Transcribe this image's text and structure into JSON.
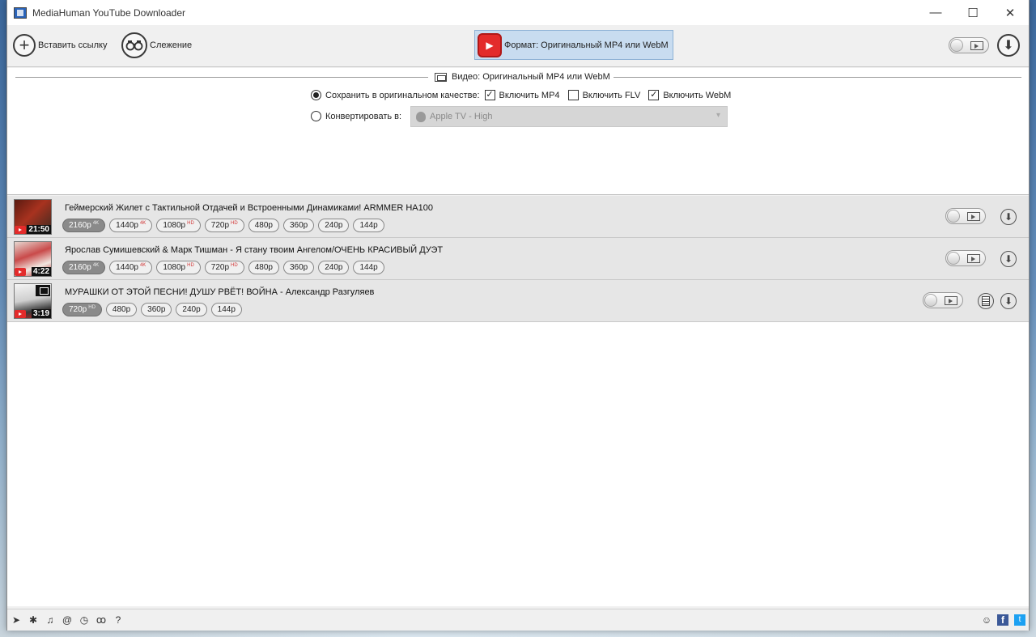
{
  "window": {
    "title": "MediaHuman YouTube Downloader"
  },
  "titlebar": {
    "minimize": "—",
    "maximize": "☐",
    "close": "✕"
  },
  "toolbar": {
    "paste_label": "Вставить ссылку",
    "tracking_label": "Слежение",
    "format_label": "Формат: Оригинальный MP4 или WebM"
  },
  "format_panel": {
    "title": "Видео: Оригинальный MP4 или WebM",
    "keep_original_label": "Сохранить в оригинальном качестве:",
    "include_mp4_label": "Включить MP4",
    "include_flv_label": "Включить FLV",
    "include_webm_label": "Включить WebM",
    "convert_label": "Конвертировать в:",
    "convert_preset": "Apple TV - High",
    "keep_original_selected": true,
    "include_mp4": true,
    "include_flv": false,
    "include_webm": true
  },
  "videos": [
    {
      "title": "Геймерский Жилет с Тактильной Отдачей и Встроенными Динамиками! ARMMER HA100",
      "duration": "21:50",
      "qualities": [
        {
          "label": "2160p",
          "badge": "4K",
          "selected": true
        },
        {
          "label": "1440p",
          "badge": "4K"
        },
        {
          "label": "1080p",
          "badge": "HD"
        },
        {
          "label": "720p",
          "badge": "HD"
        },
        {
          "label": "480p",
          "badge": ""
        },
        {
          "label": "360p",
          "badge": ""
        },
        {
          "label": "240p",
          "badge": ""
        },
        {
          "label": "144p",
          "badge": ""
        }
      ]
    },
    {
      "title": "Ярослав Сумишевский & Марк Тишман - Я стану твоим Ангелом/ОЧЕНЬ КРАСИВЫЙ ДУЭТ",
      "duration": "4:22",
      "qualities": [
        {
          "label": "2160p",
          "badge": "4K",
          "selected": true
        },
        {
          "label": "1440p",
          "badge": "4K"
        },
        {
          "label": "1080p",
          "badge": "HD"
        },
        {
          "label": "720p",
          "badge": "HD"
        },
        {
          "label": "480p",
          "badge": ""
        },
        {
          "label": "360p",
          "badge": ""
        },
        {
          "label": "240p",
          "badge": ""
        },
        {
          "label": "144p",
          "badge": ""
        }
      ]
    },
    {
      "title": "МУРАШКИ ОТ ЭТОЙ ПЕСНИ! ДУШУ РВЁТ! ВОЙНА - Александр Разгуляев",
      "duration": "3:19",
      "qualities": [
        {
          "label": "720p",
          "badge": "HD",
          "selected": true
        },
        {
          "label": "480p",
          "badge": ""
        },
        {
          "label": "360p",
          "badge": ""
        },
        {
          "label": "240p",
          "badge": ""
        },
        {
          "label": "144p",
          "badge": ""
        }
      ]
    }
  ],
  "statusbar": {
    "icons": [
      "send-icon",
      "gear-icon",
      "music-note-icon",
      "snail-icon",
      "clock-icon",
      "binoculars-icon",
      "help-icon"
    ],
    "social": [
      "support-icon",
      "facebook-icon",
      "twitter-icon"
    ]
  },
  "colors": {
    "accent": "#c8dcf0",
    "youtube_red": "#e32b2b",
    "facebook": "#3b5998",
    "twitter": "#1da1f2"
  }
}
